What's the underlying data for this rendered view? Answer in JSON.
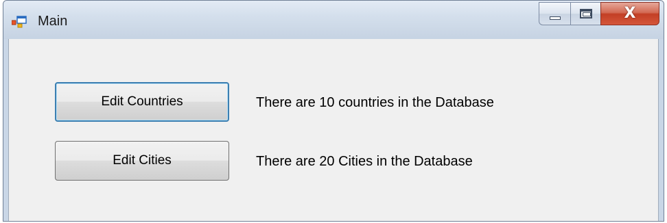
{
  "window": {
    "title": "Main",
    "icon": "winforms-app-icon",
    "caption_buttons": {
      "minimize_icon": "minimize-icon",
      "maximize_icon": "maximize-icon",
      "close_glyph": "X"
    }
  },
  "form": {
    "buttons": [
      {
        "label": "Edit Countries",
        "focused": true
      },
      {
        "label": "Edit Cities",
        "focused": false
      }
    ],
    "labels": {
      "countries_text": "There are 10 countries in the Database",
      "cities_text": "There are 20 Cities in the Database"
    }
  },
  "colors": {
    "titlebar": "#d4dfec",
    "client_background": "#f0f0f0",
    "close_button": "#c33f25",
    "focus_border": "#3c7fb1"
  }
}
